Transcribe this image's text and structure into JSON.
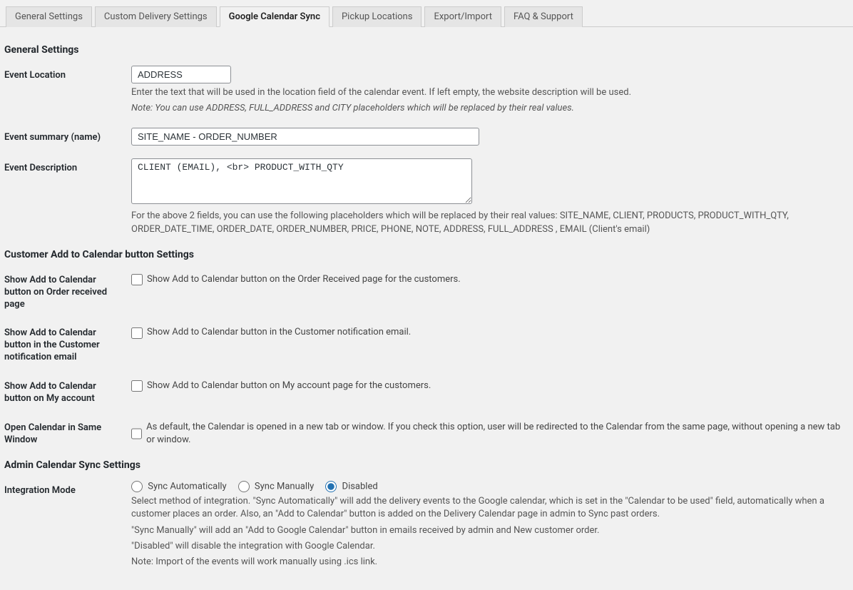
{
  "tabs": {
    "general": "General Settings",
    "custom": "Custom Delivery Settings",
    "gcal": "Google Calendar Sync",
    "pickup": "Pickup Locations",
    "export": "Export/Import",
    "faq": "FAQ & Support"
  },
  "sections": {
    "general": "General Settings",
    "customer_btn": "Customer Add to Calendar button Settings",
    "admin_sync": "Admin Calendar Sync Settings"
  },
  "fields": {
    "event_location": {
      "label": "Event Location",
      "value": "ADDRESS",
      "help": "Enter the text that will be used in the location field of the calendar event. If left empty, the website description will be used.",
      "note": "Note: You can use ADDRESS, FULL_ADDRESS and CITY placeholders which will be replaced by their real values."
    },
    "event_summary": {
      "label": "Event summary (name)",
      "value": "SITE_NAME - ORDER_NUMBER"
    },
    "event_description": {
      "label": "Event Description",
      "value": "CLIENT (EMAIL), <br> PRODUCT_WITH_QTY",
      "combined_help": "For the above 2 fields, you can use the following placeholders which will be replaced by their real values: SITE_NAME, CLIENT, PRODUCTS, PRODUCT_WITH_QTY, ORDER_DATE_TIME, ORDER_DATE, ORDER_NUMBER, PRICE, PHONE, NOTE, ADDRESS, FULL_ADDRESS , EMAIL (Client's email)"
    },
    "show_on_order_received": {
      "label": "Show Add to Calendar button on Order received page",
      "text": "Show Add to Calendar button on the Order Received page for the customers.",
      "checked": false
    },
    "show_in_email": {
      "label": "Show Add to Calendar button in the Customer notification email",
      "text": "Show Add to Calendar button in the Customer notification email.",
      "checked": false
    },
    "show_on_my_account": {
      "label": "Show Add to Calendar button on My account",
      "text": "Show Add to Calendar button on My account page for the customers.",
      "checked": false
    },
    "open_same_window": {
      "label": "Open Calendar in Same Window",
      "text": "As default, the Calendar is opened in a new tab or window. If you check this option, user will be redirected to the Calendar from the same page, without opening a new tab or window.",
      "checked": false
    },
    "integration_mode": {
      "label": "Integration Mode",
      "options": {
        "auto": "Sync Automatically",
        "manual": "Sync Manually",
        "disabled": "Disabled"
      },
      "selected": "disabled",
      "help_line1": "Select method of integration. \"Sync Automatically\" will add the delivery events to the Google calendar, which is set in the \"Calendar to be used\" field, automatically when a customer places an order. Also, an \"Add to Calendar\" button is added on the Delivery Calendar page in admin to Sync past orders.",
      "help_line2": "\"Sync Manually\" will add an \"Add to Google Calendar\" button in emails received by admin and New customer order.",
      "help_line3": "\"Disabled\" will disable the integration with Google Calendar.",
      "help_line4": "Note: Import of the events will work manually using .ics link."
    }
  }
}
